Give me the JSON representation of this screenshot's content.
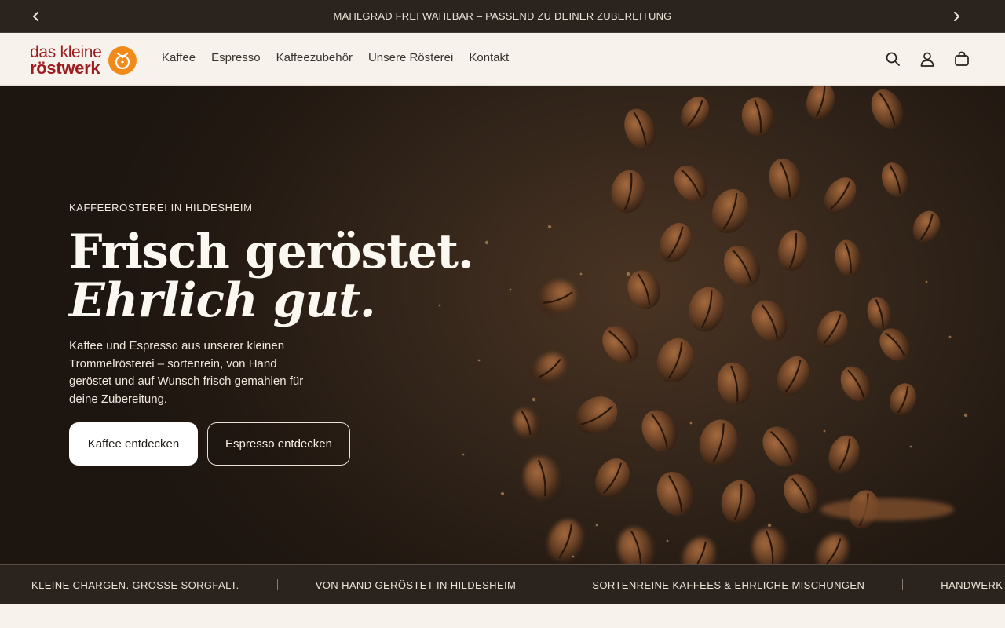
{
  "announcement": {
    "text": "MAHLGRAD FREI WAHLBAR – PASSEND ZU DEINER ZUBEREITUNG",
    "prev_icon": "chevron-left-icon",
    "next_icon": "chevron-right-icon"
  },
  "header": {
    "logo": {
      "line1": "das kleine",
      "line2": "röstwerk",
      "brand_color": "#9d1c1f",
      "mark_color": "#f08a18"
    },
    "nav": [
      {
        "label": "Kaffee"
      },
      {
        "label": "Espresso"
      },
      {
        "label": "Kaffeezubehör"
      },
      {
        "label": "Unsere Rösterei"
      },
      {
        "label": "Kontakt"
      }
    ],
    "icons": [
      "search-icon",
      "account-icon",
      "cart-icon"
    ]
  },
  "hero": {
    "kicker": "KAFFEERÖSTEREI IN HILDESHEIM",
    "title_line1": "Frisch geröstet.",
    "title_line2": "Ehrlich gut.",
    "lead": "Kaffee und Espresso aus unserer kleinen Trommelrösterei – sortenrein, von Hand geröstet und auf Wunsch frisch gemahlen für deine Zubereitung.",
    "cta_primary": "Kaffee entdecken",
    "cta_secondary": "Espresso entdecken"
  },
  "marquee": {
    "items": [
      "KLEINE CHARGEN. GROSSE SORGFALT.",
      "VON HAND GERÖSTET IN HILDESHEIM",
      "SORTENREINE KAFFEES & EHRLICHE MISCHUNGEN",
      "HANDWERK STATT INDUSTRIE"
    ]
  },
  "colors": {
    "announce_bg": "#2b231d",
    "page_bg": "#f7f2ec",
    "hero_dark": "#221912",
    "bean": "#6b4226"
  }
}
